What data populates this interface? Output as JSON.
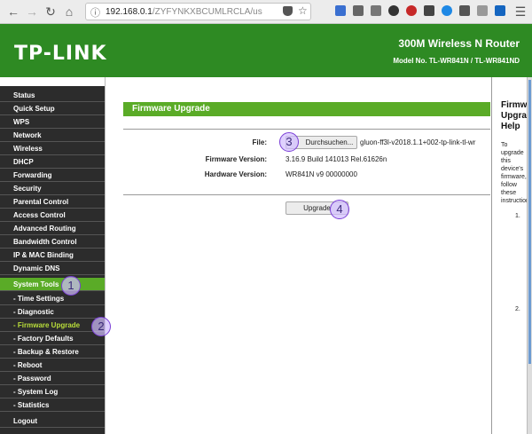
{
  "browser": {
    "url_host": "192.168.0.1",
    "url_path": "/ZYFYNKXBCUMLRCLA/us"
  },
  "header": {
    "logo": "TP-LINK",
    "router_name": "300M Wireless N Router",
    "model_no": "Model No. TL-WR841N / TL-WR841ND"
  },
  "sidebar": {
    "items": [
      {
        "label": "Status"
      },
      {
        "label": "Quick Setup"
      },
      {
        "label": "WPS"
      },
      {
        "label": "Network"
      },
      {
        "label": "Wireless"
      },
      {
        "label": "DHCP"
      },
      {
        "label": "Forwarding"
      },
      {
        "label": "Security"
      },
      {
        "label": "Parental Control"
      },
      {
        "label": "Access Control"
      },
      {
        "label": "Advanced Routing"
      },
      {
        "label": "Bandwidth Control"
      },
      {
        "label": "IP & MAC Binding"
      },
      {
        "label": "Dynamic DNS"
      },
      {
        "label": "System Tools"
      },
      {
        "label": "- Time Settings"
      },
      {
        "label": "- Diagnostic"
      },
      {
        "label": "- Firmware Upgrade"
      },
      {
        "label": "- Factory Defaults"
      },
      {
        "label": "- Backup & Restore"
      },
      {
        "label": "- Reboot"
      },
      {
        "label": "- Password"
      },
      {
        "label": "- System Log"
      },
      {
        "label": "- Statistics"
      },
      {
        "label": "Logout"
      }
    ]
  },
  "main": {
    "section_title": "Firmware Upgrade",
    "file_label": "File:",
    "browse_label": "Durchsuchen...",
    "file_name": "gluon-ff3l-v2018.1.1+002-tp-link-tl-wr",
    "firmware_label": "Firmware Version:",
    "firmware_value": "3.16.9 Build 141013 Rel.61626n",
    "hardware_label": "Hardware Version:",
    "hardware_value": "WR841N v9 00000000",
    "upgrade_label": "Upgrade"
  },
  "help": {
    "title": "Firmware Upgrade Help",
    "intro": "To upgrade this device's firmware, follow these instructions:",
    "step1": "1.",
    "step2": "2."
  },
  "markers": [
    "1",
    "2",
    "3",
    "4"
  ],
  "colors": {
    "brand_green": "#2e8a23",
    "accent_green": "#5aab27",
    "sidebar_bg": "#2c2c2c",
    "submenu_active": "#b9de3a",
    "marker": "#7b3fd6"
  }
}
